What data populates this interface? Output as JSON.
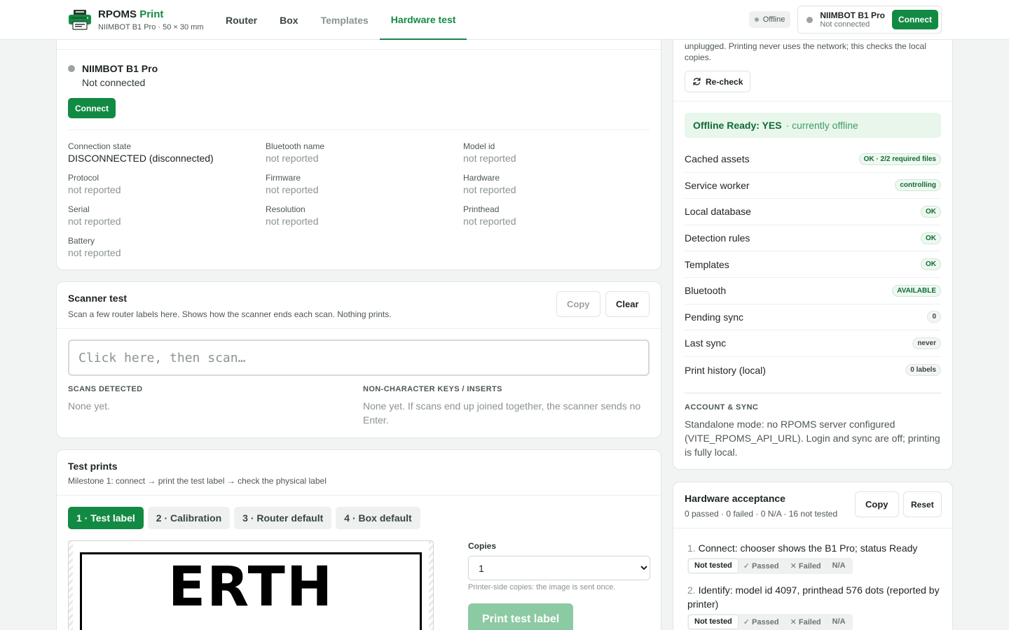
{
  "app": {
    "name": "RPOMS",
    "name_accent": "Print",
    "device_line": "NIIMBOT B1 Pro · 50 × 30 mm"
  },
  "nav": {
    "tabs": [
      {
        "label": "Router"
      },
      {
        "label": "Box"
      },
      {
        "label": "Templates"
      },
      {
        "label": "Hardware test"
      }
    ]
  },
  "header": {
    "offline_label": "Offline",
    "printer_name": "NIIMBOT B1 Pro",
    "printer_state": "Not connected",
    "connect_label": "Connect"
  },
  "printer_card": {
    "name": "NIIMBOT B1 Pro",
    "state": "Not connected",
    "connect_label": "Connect",
    "fields": [
      {
        "label": "Connection state",
        "value": "DISCONNECTED (disconnected)"
      },
      {
        "label": "Bluetooth name",
        "value": "not reported"
      },
      {
        "label": "Model id",
        "value": "not reported"
      },
      {
        "label": "Protocol",
        "value": "not reported"
      },
      {
        "label": "Firmware",
        "value": "not reported"
      },
      {
        "label": "Hardware",
        "value": "not reported"
      },
      {
        "label": "Serial",
        "value": "not reported"
      },
      {
        "label": "Resolution",
        "value": "not reported"
      },
      {
        "label": "Printhead",
        "value": "not reported"
      },
      {
        "label": "Battery",
        "value": "not reported"
      }
    ]
  },
  "scanner": {
    "title": "Scanner test",
    "subtitle": "Scan a few router labels here. Shows how the scanner ends each scan. Nothing prints.",
    "copy_label": "Copy",
    "clear_label": "Clear",
    "placeholder": "Click here, then scan…",
    "scans_heading": "SCANS DETECTED",
    "scans_text": "None yet.",
    "keys_heading": "NON-CHARACTER KEYS / INSERTS",
    "keys_text": "None yet. If scans end up joined together, the scanner sends no Enter."
  },
  "test_prints": {
    "title": "Test prints",
    "subtitle": "Milestone 1: connect → print the test label → check the physical label",
    "tabs": [
      {
        "label": "1 · Test label"
      },
      {
        "label": "2 · Calibration"
      },
      {
        "label": "3 · Router default"
      },
      {
        "label": "4 · Box default"
      }
    ],
    "label_text": "ERTH",
    "copies_label": "Copies",
    "copies_value": "1",
    "copies_hint": "Printer-side copies: the image is sent once.",
    "print_label": "Print test label"
  },
  "offline_card": {
    "intro": "unplugged. Printing never uses the network; this checks the local copies.",
    "recheck_label": "Re-check",
    "ready_main": "Offline Ready: YES",
    "ready_sub": "· currently offline",
    "checks": [
      {
        "label": "Cached assets",
        "badge": "OK · 2/2 required files",
        "kind": "ok"
      },
      {
        "label": "Service worker",
        "badge": "controlling",
        "kind": "ok"
      },
      {
        "label": "Local database",
        "badge": "OK",
        "kind": "ok"
      },
      {
        "label": "Detection rules",
        "badge": "OK",
        "kind": "ok"
      },
      {
        "label": "Templates",
        "badge": "OK",
        "kind": "ok"
      },
      {
        "label": "Bluetooth",
        "badge": "AVAILABLE",
        "kind": "ok"
      },
      {
        "label": "Pending sync",
        "badge": "0",
        "kind": "neutral"
      },
      {
        "label": "Last sync",
        "badge": "never",
        "kind": "neutral"
      },
      {
        "label": "Print history (local)",
        "badge": "0 labels",
        "kind": "neutral"
      }
    ],
    "account_heading": "ACCOUNT & SYNC",
    "account_text": "Standalone mode: no RPOMS server configured (VITE_RPOMS_API_URL). Login and sync are off; printing is fully local."
  },
  "hardware_acceptance": {
    "title": "Hardware acceptance",
    "summary": "0 passed · 0 failed · 0 N/A · 16 not tested",
    "copy_label": "Copy",
    "reset_label": "Reset",
    "items": [
      {
        "num": "1.",
        "text": "Connect: chooser shows the B1 Pro; status Ready"
      },
      {
        "num": "2.",
        "text": "Identify: model id 4097, printhead 576 dots (reported by printer)"
      }
    ],
    "status_options": [
      "Not tested",
      "✓ Passed",
      "✕ Failed",
      "N/A"
    ]
  },
  "colors": {
    "accent": "#138a43",
    "accent_disabled": "#8ccaa3",
    "ready_bg": "#e8f6ec"
  }
}
